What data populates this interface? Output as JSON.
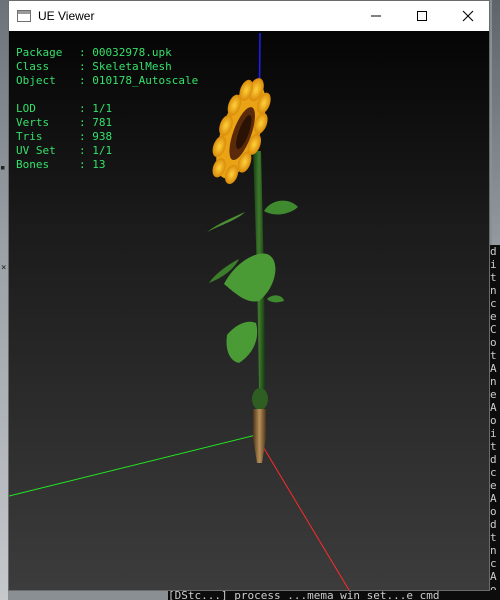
{
  "window": {
    "title": "UE Viewer",
    "controls": {
      "minimize": "minimize",
      "maximize": "maximize",
      "close": "close"
    }
  },
  "info": {
    "group1": [
      {
        "label": "Package",
        "value": "00032978.upk"
      },
      {
        "label": "Class",
        "value": "SkeletalMesh"
      },
      {
        "label": "Object",
        "value": "010178_Autoscale"
      }
    ],
    "group2": [
      {
        "label": "LOD",
        "value": "1/1"
      },
      {
        "label": "Verts",
        "value": "781"
      },
      {
        "label": "Tris",
        "value": "938"
      },
      {
        "label": "UV Set",
        "value": "1/1"
      },
      {
        "label": "Bones",
        "value": "13"
      }
    ],
    "separator": ": "
  },
  "background": {
    "console_bottom_text": "[DStc...] process  ...mema win set...e  cmd",
    "console_right_chars": [
      "d",
      "i",
      "t",
      "n",
      "c",
      "e",
      "C",
      "o",
      "t",
      "A",
      "n",
      "e",
      "A",
      "o",
      "i",
      "t",
      "d",
      "c",
      "e",
      "A",
      "o",
      "d",
      "t",
      "n",
      "c",
      "A",
      "o",
      "d"
    ]
  },
  "colors": {
    "info_text": "#35e06b",
    "axis_x": "#ff2a2a",
    "axis_y": "#22e622",
    "axis_z": "#1e1eff"
  }
}
